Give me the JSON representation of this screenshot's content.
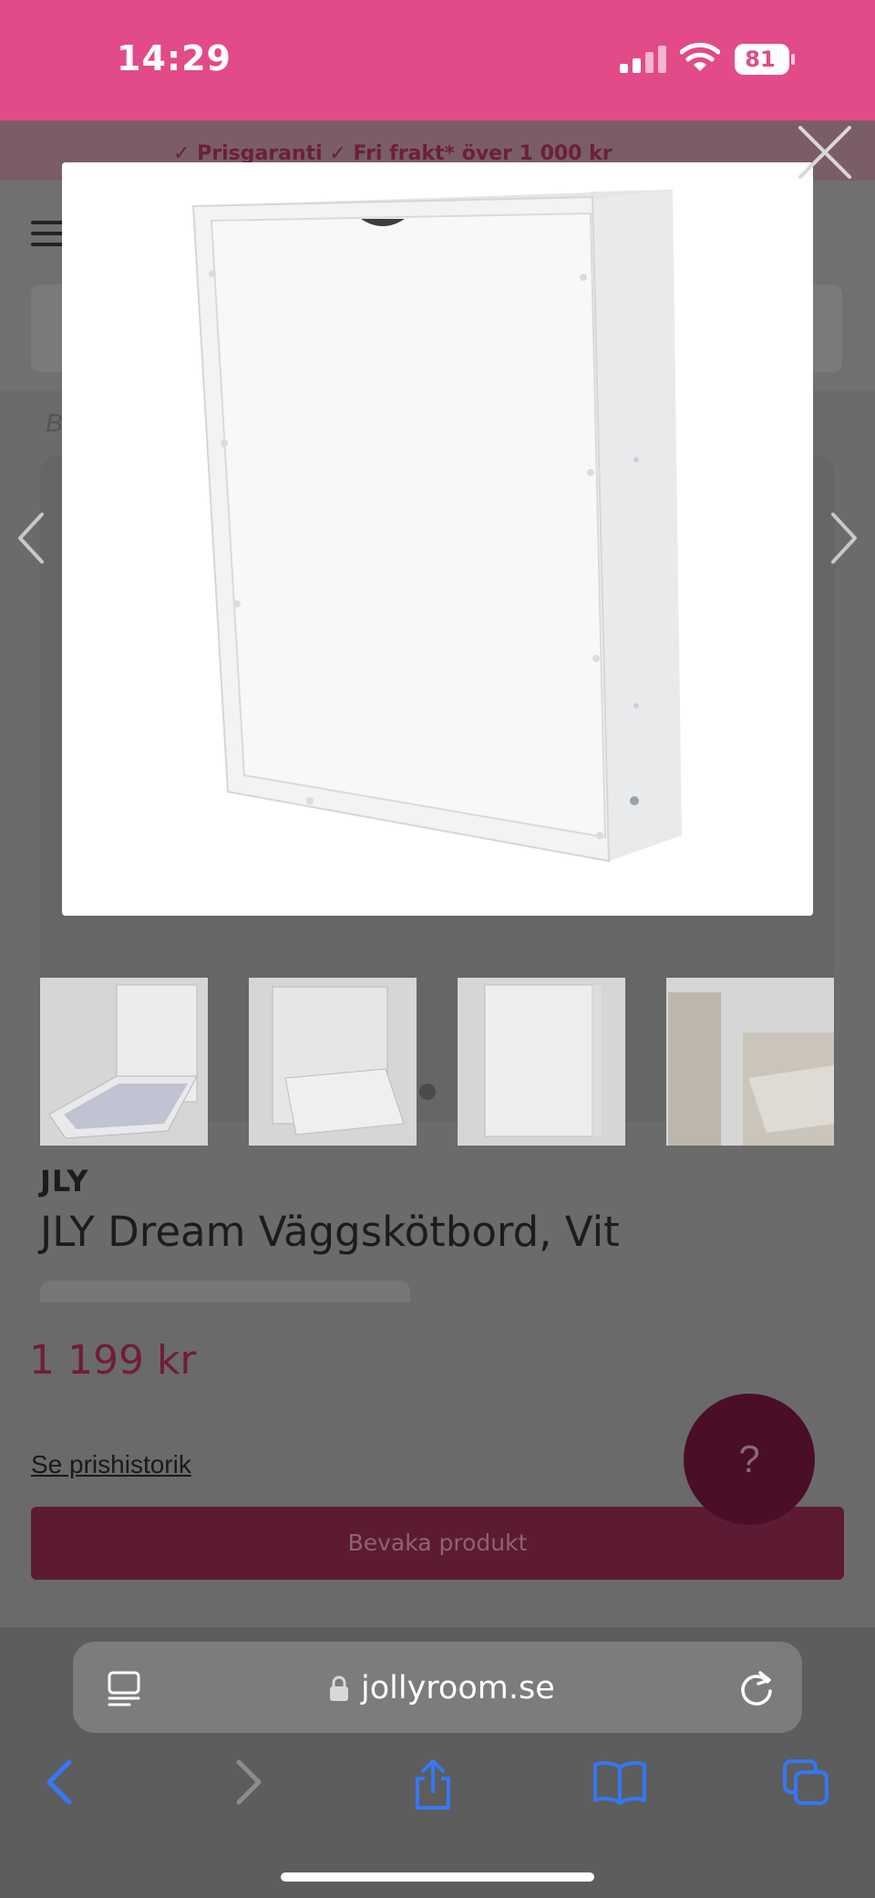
{
  "status_bar": {
    "time": "14:29",
    "battery": "81"
  },
  "promo": {
    "text": "✓ Prisgaranti   ✓ Fri frakt* över 1 000 kr"
  },
  "breadcrumb": {
    "text": "B"
  },
  "product": {
    "brand": "JLY",
    "title": "JLY Dream Väggskötbord, Vit",
    "price": "1 199 kr",
    "price_history_link": "Se prishistorik",
    "watch_button": "Bevaka produkt"
  },
  "help": {
    "label": "?"
  },
  "browser": {
    "url": "jollyroom.se"
  },
  "icons": {
    "close": "close-icon",
    "prev": "chevron-left-icon",
    "next": "chevron-right-icon",
    "menu": "hamburger-icon",
    "reader": "reader-icon",
    "lock": "lock-icon",
    "reload": "reload-icon",
    "back": "back-icon",
    "forward": "forward-icon",
    "share": "share-icon",
    "bookmarks": "bookmarks-icon",
    "tabs": "tabs-icon"
  },
  "colors": {
    "status_bar": "#e24a8a",
    "price": "#6e1d3a",
    "watch_button": "#5c1b33",
    "link": "#3478f6"
  }
}
